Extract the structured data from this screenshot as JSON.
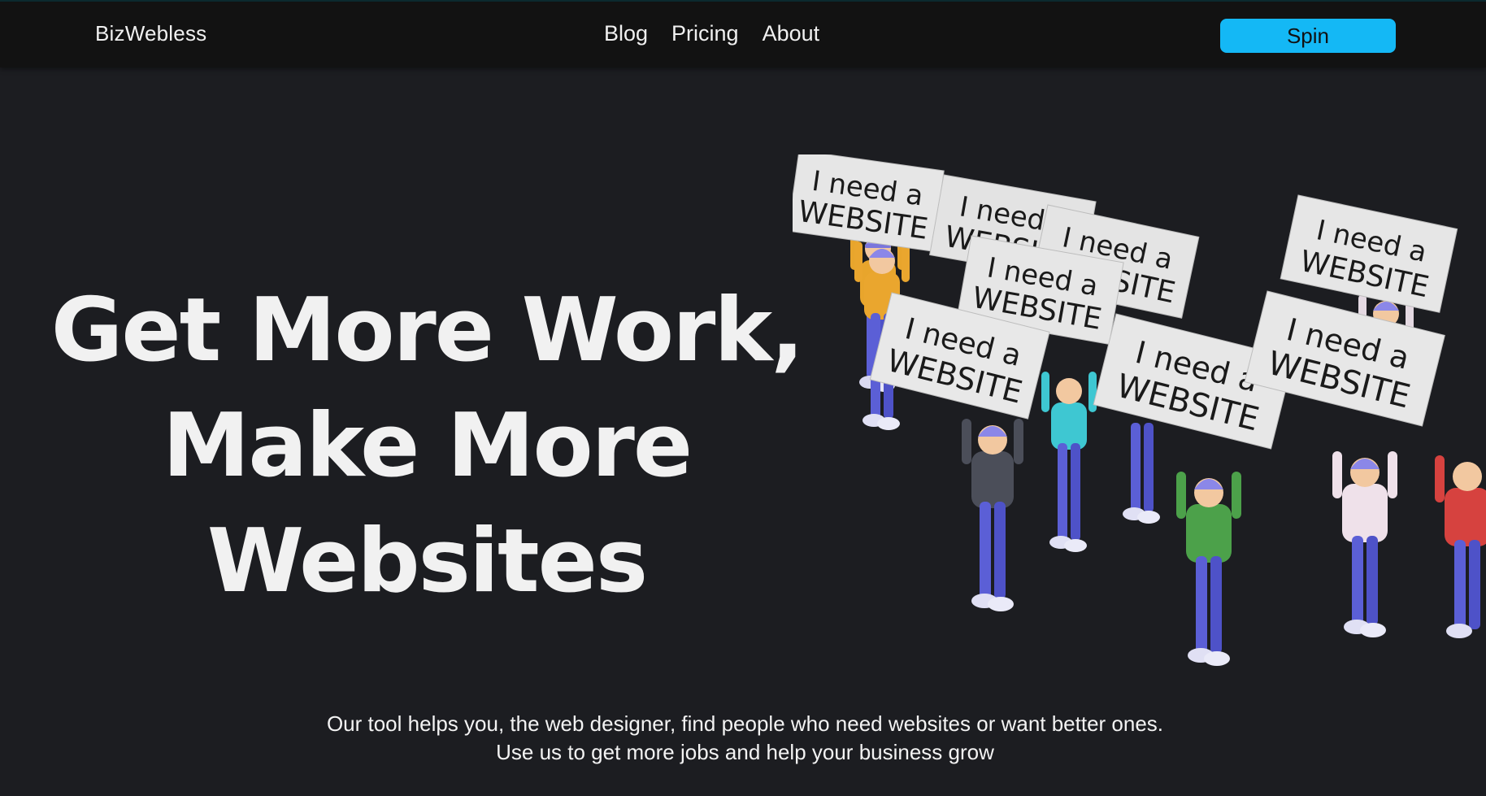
{
  "header": {
    "brand": "BizWebless",
    "nav": [
      "Blog",
      "Pricing",
      "About"
    ],
    "cta_label": "Spin"
  },
  "hero": {
    "headline": [
      "Get More Work,",
      "Make More",
      "Websites"
    ],
    "sign_text_line1": "I need a",
    "sign_text_line2": "WEBSITE",
    "tagline": [
      "Our tool helps you, the web designer, find people who need websites or want better ones.",
      "Use us to get more jobs and help your business grow"
    ]
  },
  "colors": {
    "background": "#1c1d21",
    "header_bg": "#121212",
    "cta": "#14b8f5",
    "pants": "#5b5fd6",
    "cap": "#8b87e8"
  }
}
